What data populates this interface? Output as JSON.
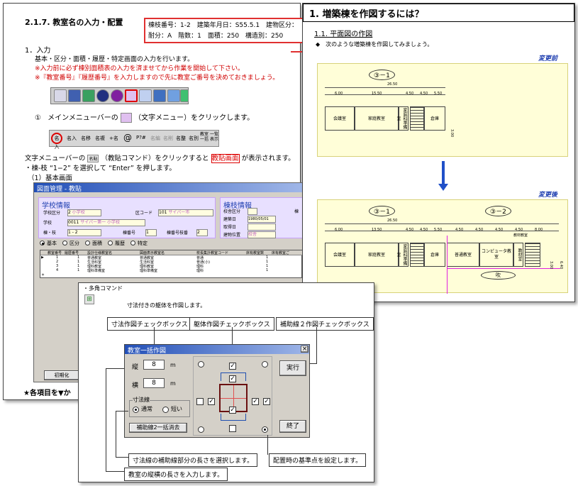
{
  "left_page": {
    "section": "2.1.7. 教室名の入力・配置",
    "info_line1": "棟枝番号：1-2　建築年月日：S55.5.1　建物区分：",
    "info_line2": "耐分：A　階数：1　面積：250　構造別：250",
    "heading": "1．入力",
    "desc": "基本・区分・面積・履歴・特定画面の入力を行います。",
    "note1": "※入力前に必ず棟別面積表の入力を済ませてから作業を開始して下さい。",
    "note2": "※『教室番号』『履歴番号』を入力しますので先に教室ご番号を決めておきましょう。",
    "step1_circle": "①",
    "step1_a": "メインメニューバーの",
    "step1_b": "（文字メニュー）をクリックします。",
    "text_menu_items": [
      "名入",
      "名入",
      "名移",
      "名複",
      "+名",
      "@",
      "P?#",
      "名編",
      "名削",
      "名整",
      "名別",
      "教室一括",
      "一覧表示"
    ],
    "line2_a": "文字メニューバーの",
    "line2_icon": "名貼",
    "line2_b": "（教貼コマンド）をクリックすると",
    "line2_hl": "教貼画面",
    "line2_c": "が表示されます。",
    "line3": "・棟-枝 “1−2” を選択して “Enter” を押します。",
    "line4": "（1）基本画面",
    "bottom_note": "★各項目を▼か"
  },
  "window": {
    "title": "図面管理 - 教貼",
    "school_group": "学校情報",
    "bldg_group": "棟枝情報",
    "school_kubun": "学校区分",
    "school_kubun_val": "2",
    "school_kubun_txt": "小学校",
    "school": "学校",
    "school_val": "0011",
    "school_txt": "サイバー第一 小学校",
    "ku_code": "区コード",
    "ku_val": "101",
    "ku_txt": "サイバー市",
    "tou_eda": "棟・枝",
    "tou_eda_val": "1 - 2",
    "tou_no": "棟番号",
    "tou_no_val": "1",
    "tou_eda_no": "棟番号枝番",
    "tou_eda_no_val": "2",
    "bldg_kubun": "校舎区分",
    "bldg_date": "建築日",
    "bldg_date_val": "1980/05/01",
    "acq_date": "取得日",
    "bldg_pos": "建物位置",
    "bldg_pos_val": "校舎",
    "right_lbl": "棟",
    "tabs": [
      "基本",
      "区分",
      "面積",
      "履歴",
      "特定"
    ],
    "grid_headers": [
      "教室番号",
      "履歴番号",
      "設計仕様教室名",
      "図面表示教室名",
      "校長集計教室コード",
      "床有教室数",
      "床有教室ご"
    ],
    "grid_rows": [
      [
        "1",
        "1",
        "普通教室",
        "普通教室",
        "普通",
        "1"
      ],
      [
        "2",
        "1",
        "生活科室",
        "生活科室",
        "普通(小)",
        "1"
      ],
      [
        "3",
        "1",
        "理科教室",
        "理科教室",
        "理科",
        "1"
      ],
      [
        "4",
        "1",
        "理科準備室",
        "理科準備室",
        "理科",
        "1"
      ]
    ],
    "init_btn": "初期化"
  },
  "right_page": {
    "title": "1. 増築棟を作図するには？",
    "sub": "1.1. 平面図の作図",
    "bullet": "◆　次のような増築棟を作図してみましょう。",
    "before_label": "変更前",
    "after_label": "変更後",
    "bldg1": "③－1",
    "bldg2": "③－2",
    "dims_total": "26.50",
    "dims_before": [
      "6.00",
      "15.50",
      "4.50",
      "4.50",
      "5.50"
    ],
    "dims_after": [
      "6.00",
      "13.50",
      "4.50",
      "4.50",
      "5.50",
      "4.50",
      "4.50",
      "4.50",
      "4.50",
      "8.00"
    ],
    "rooms_before": [
      "会議室",
      "家庭教室",
      "家庭科準備室",
      "倉庫"
    ],
    "rooms_after": [
      "会議室",
      "家庭教室",
      "家庭科準備室",
      "倉庫",
      "普通教室",
      "コンピュータ教室",
      "教材室",
      "教材教室"
    ],
    "fukinuke": "吹",
    "side_dim": "3.00",
    "side_dim2": "6.40"
  },
  "dialog": {
    "cmd_title": "・多角コマンド",
    "cmd_desc": "寸法付きの躯体を作図します。",
    "callout_dim": "寸法作図チェックボックス",
    "callout_body": "躯体作図チェックボックス",
    "callout_aux": "補助線２作図チェックボックス",
    "title": "教室一括作図",
    "close": "×",
    "tate": "縦",
    "tate_val": "8",
    "yoko": "横",
    "yoko_val": "8",
    "unit": "m",
    "sunpou_group": "寸法線",
    "opt_normal": "通常",
    "opt_short": "短い",
    "clear_btn": "補助線2一括消去",
    "run_btn": "実行",
    "end_btn": "終了",
    "check_mark": "✓",
    "note_len": "寸法線の補助線部分の長さを選択します。",
    "note_base": "配置時の基準点を設定します。",
    "note_size": "教室の縦横の長さを入力します。"
  },
  "colors": {
    "red": "#d00000",
    "blue": "#1f3fb0",
    "plan_bg": "#fffed8",
    "arrow_blue": "#2050c8"
  }
}
